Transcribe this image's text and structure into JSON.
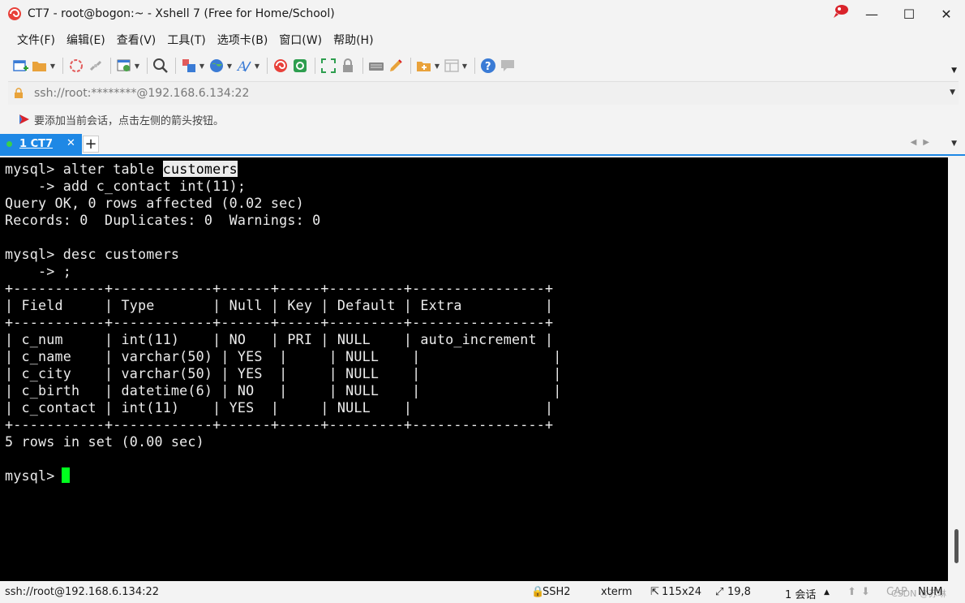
{
  "window": {
    "title": "CT7 - root@bogon:~ - Xshell 7 (Free for Home/School)",
    "controls": [
      "—",
      "☐",
      "✕"
    ]
  },
  "menu": [
    "文件(F)",
    "编辑(E)",
    "查看(V)",
    "工具(T)",
    "选项卡(B)",
    "窗口(W)",
    "帮助(H)"
  ],
  "address": {
    "value": "ssh://root:********@192.168.6.134:22"
  },
  "hint": {
    "text": "要添加当前会话，点击左侧的箭头按钮。"
  },
  "tabs": [
    {
      "label": "1 CT7",
      "close": "✕",
      "active": true
    }
  ],
  "tab_add_label": "+",
  "terminal": {
    "lines": [
      {
        "pre": "mysql> alter table ",
        "hl": "customers",
        "post": ""
      },
      {
        "pre": "    -> add c_contact int(11);",
        "hl": "",
        "post": ""
      },
      {
        "pre": "Query OK, 0 rows affected (0.02 sec)",
        "hl": "",
        "post": ""
      },
      {
        "pre": "Records: 0  Duplicates: 0  Warnings: 0",
        "hl": "",
        "post": ""
      },
      {
        "pre": "",
        "hl": "",
        "post": ""
      },
      {
        "pre": "mysql> desc customers",
        "hl": "",
        "post": ""
      },
      {
        "pre": "    -> ;",
        "hl": "",
        "post": ""
      },
      {
        "pre": "+-----------+------------+------+-----+---------+----------------+",
        "hl": "",
        "post": ""
      },
      {
        "pre": "| Field     | Type       | Null | Key | Default | Extra          |",
        "hl": "",
        "post": ""
      },
      {
        "pre": "+-----------+------------+------+-----+---------+----------------+",
        "hl": "",
        "post": ""
      },
      {
        "pre": "| c_num     | int(11)    | NO   | PRI | NULL    | auto_increment |",
        "hl": "",
        "post": ""
      },
      {
        "pre": "| c_name    | varchar(50) | YES  |     | NULL    |                |",
        "hl": "",
        "post": ""
      },
      {
        "pre": "| c_city    | varchar(50) | YES  |     | NULL    |                |",
        "hl": "",
        "post": ""
      },
      {
        "pre": "| c_birth   | datetime(6) | NO   |     | NULL    |                |",
        "hl": "",
        "post": ""
      },
      {
        "pre": "| c_contact | int(11)    | YES  |     | NULL    |                |",
        "hl": "",
        "post": ""
      },
      {
        "pre": "+-----------+------------+------+-----+---------+----------------+",
        "hl": "",
        "post": ""
      },
      {
        "pre": "5 rows in set (0.00 sec)",
        "hl": "",
        "post": ""
      },
      {
        "pre": "",
        "hl": "",
        "post": ""
      },
      {
        "pre": "mysql> ",
        "hl": "",
        "post": ""
      }
    ]
  },
  "status": {
    "connection": "ssh://root@192.168.6.134:22",
    "protocol": "SSH2",
    "term": "xterm",
    "size": "115x24",
    "cursor_pos": "19,8",
    "sessions": "1 会话",
    "caps": "CAP",
    "num": "NUM",
    "watermark": "CSDN @苏琳"
  },
  "colors": {
    "accent": "#1e88e5",
    "terminal_bg": "#000000",
    "terminal_fg": "#ececec",
    "cursor": "#00ff1e"
  }
}
